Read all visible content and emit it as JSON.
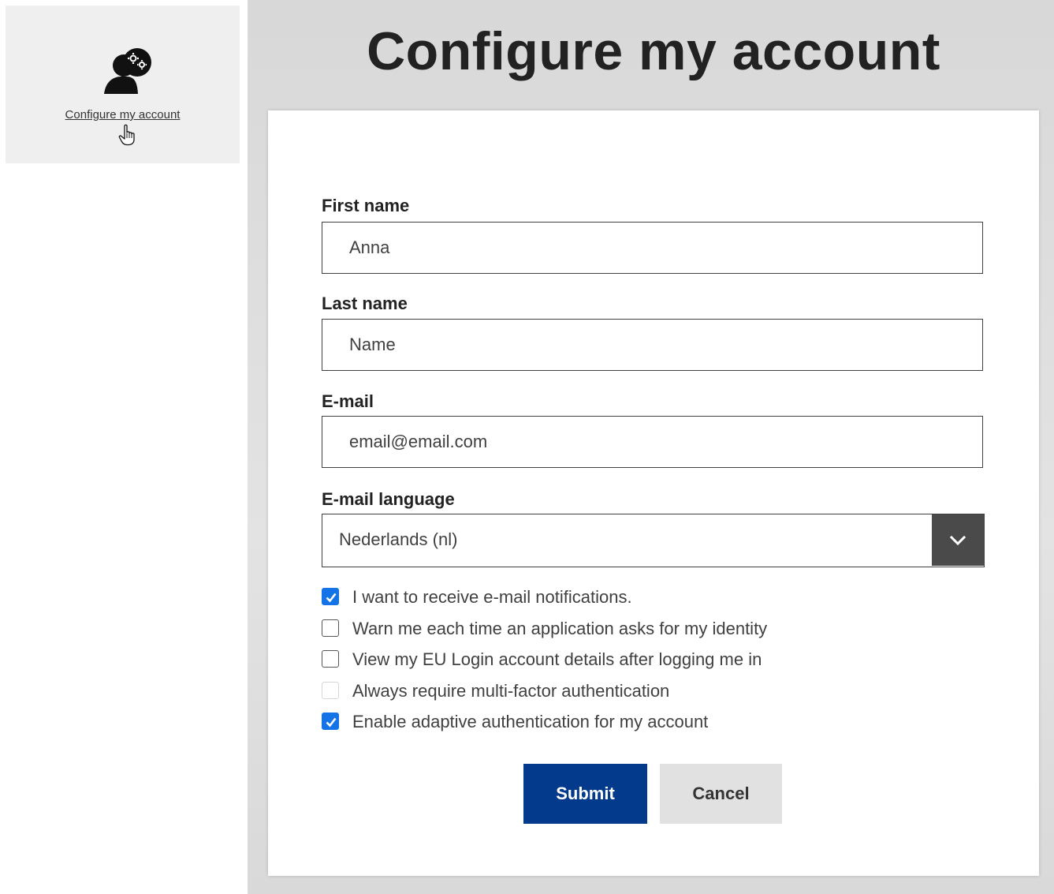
{
  "sidebar": {
    "tile": {
      "link_label": "Configure my account",
      "icon": "user-settings-icon"
    }
  },
  "page": {
    "title": "Configure my account"
  },
  "form": {
    "first_name": {
      "label": "First name",
      "value": "Anna"
    },
    "last_name": {
      "label": "Last name",
      "value": "Name"
    },
    "email": {
      "label": "E-mail",
      "value": "email@email.com"
    },
    "email_language": {
      "label": "E-mail language",
      "selected": "Nederlands (nl)",
      "icon": "chevron-down-icon"
    },
    "options": [
      {
        "label": "I want to receive e-mail notifications.",
        "checked": true,
        "disabled": false
      },
      {
        "label": "Warn me each time an application asks for my identity",
        "checked": false,
        "disabled": false
      },
      {
        "label": "View my EU Login account details after logging me in",
        "checked": false,
        "disabled": false
      },
      {
        "label": "Always require multi-factor authentication",
        "checked": false,
        "disabled": true
      },
      {
        "label": "Enable adaptive authentication for my account",
        "checked": true,
        "disabled": false
      }
    ],
    "submit_label": "Submit",
    "cancel_label": "Cancel"
  },
  "colors": {
    "primary_button": "#033a8c",
    "checkbox_checked": "#1473e6",
    "select_button": "#4a4a4a",
    "tile_background": "#efefef",
    "main_background": "#dcdcdc"
  }
}
